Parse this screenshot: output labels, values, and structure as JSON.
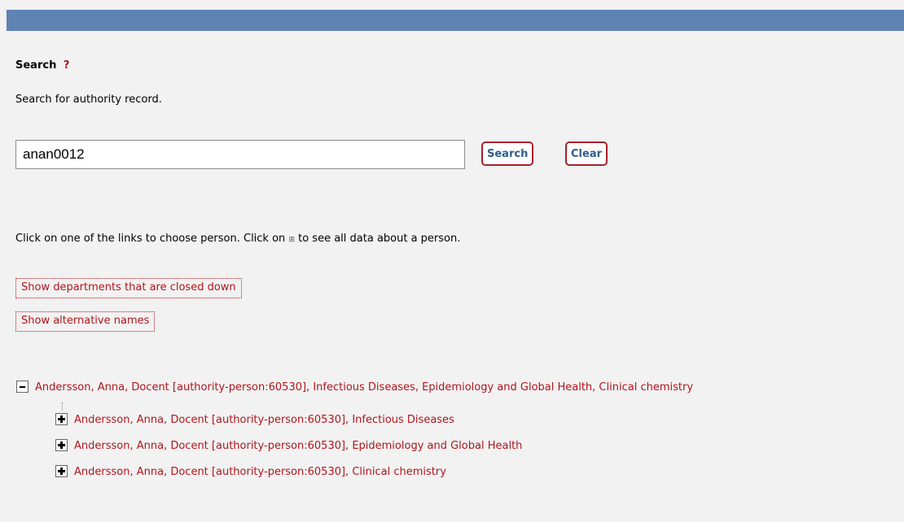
{
  "search": {
    "heading": "Search",
    "help_label": "?",
    "description": "Search for authority record.",
    "input_value": "anan0012",
    "search_button": "Search",
    "clear_button": "Clear"
  },
  "instructions": {
    "before_icon": "Click on one of the links to choose person. Click on",
    "icon_glyph": "⊞",
    "after_icon": "to see all data about a person."
  },
  "toggles": {
    "closed_departments": "Show departments that are closed down",
    "alternative_names": "Show alternative names"
  },
  "tree": {
    "root": {
      "label": "Andersson, Anna, Docent [authority-person:60530], Infectious Diseases, Epidemiology and Global Health, Clinical chemistry",
      "expanded": true
    },
    "children": [
      {
        "label": "Andersson, Anna, Docent [authority-person:60530], Infectious Diseases",
        "expanded": false
      },
      {
        "label": "Andersson, Anna, Docent [authority-person:60530], Epidemiology and Global Health",
        "expanded": false
      },
      {
        "label": "Andersson, Anna, Docent [authority-person:60530], Clinical chemistry",
        "expanded": false
      }
    ]
  },
  "colors": {
    "topbar": "#5f83b3",
    "link": "#b3141b",
    "button_text": "#2e5d8a",
    "background": "#f2f2f2"
  },
  "icons": {
    "expand": "plus-box-icon",
    "collapse": "minus-box-icon",
    "show_all": "square-grid-icon"
  }
}
